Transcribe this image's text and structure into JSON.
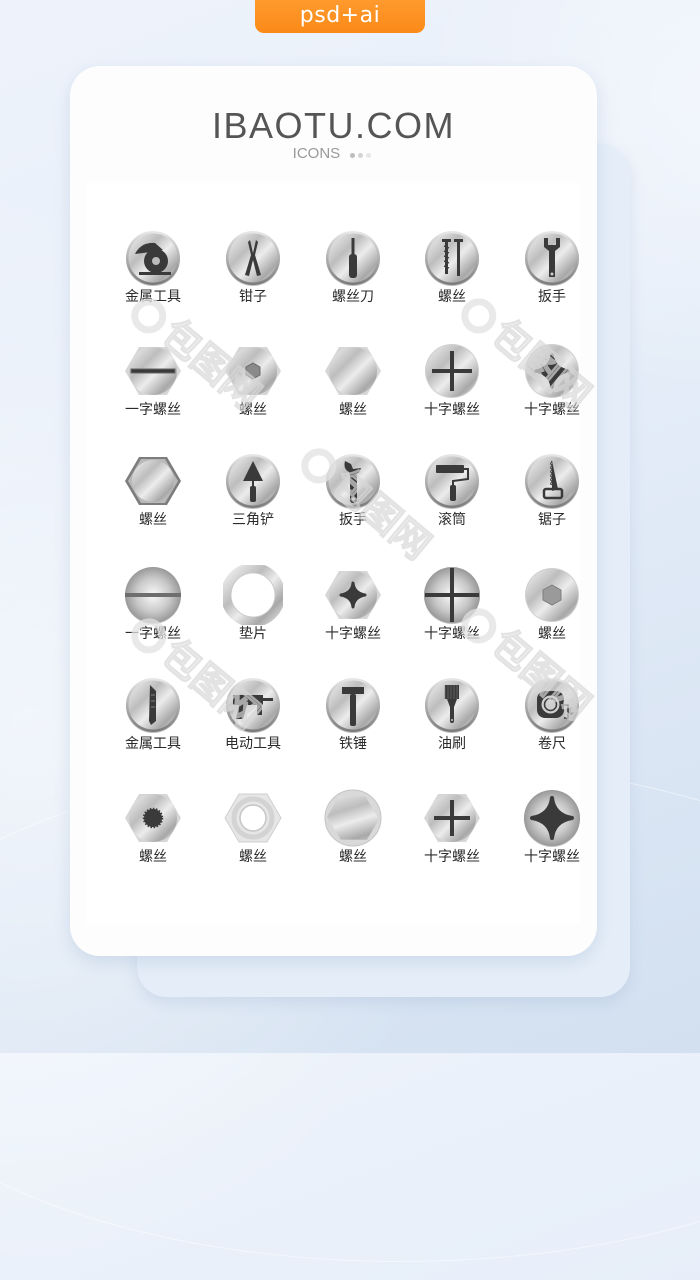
{
  "badge": {
    "label": "psd+ai"
  },
  "header": {
    "title": "IBAOTU.COM",
    "subtitle": "ICONS",
    "dot_colors": [
      "#bdbdbd",
      "#d3d3d3",
      "#e6e6e6"
    ]
  },
  "colors": {
    "badge_orange": "#fb8a17",
    "title_gray": "#555555",
    "subtitle_gray": "#999999",
    "label_dark": "#2b2b2b",
    "icon_dark": "#3a3a3a",
    "metal_light": "#f2f2f2",
    "metal_dark": "#8a8a8a"
  },
  "watermark": {
    "text": "包图网"
  },
  "icons": [
    {
      "label": "金属工具",
      "icon": "circular-saw-icon",
      "shape": "circle"
    },
    {
      "label": "钳子",
      "icon": "pliers-icon",
      "shape": "circle"
    },
    {
      "label": "螺丝刀",
      "icon": "screwdriver-icon",
      "shape": "circle"
    },
    {
      "label": "螺丝",
      "icon": "screws-icon",
      "shape": "circle"
    },
    {
      "label": "扳手",
      "icon": "wrench-icon",
      "shape": "circle"
    },
    {
      "label": "一字螺丝",
      "icon": "slotted-hex-bolt-icon",
      "shape": "hex"
    },
    {
      "label": "螺丝",
      "icon": "hex-socket-bolt-icon",
      "shape": "hex"
    },
    {
      "label": "螺丝",
      "icon": "plain-hex-bolt-icon",
      "shape": "hex"
    },
    {
      "label": "十字螺丝",
      "icon": "phillips-screw-icon",
      "shape": "circle-flat"
    },
    {
      "label": "十字螺丝",
      "icon": "phillips-screw-star-icon",
      "shape": "circle-flat"
    },
    {
      "label": "螺丝",
      "icon": "hex-nut-icon",
      "shape": "hex-dark"
    },
    {
      "label": "三角铲",
      "icon": "trowel-icon",
      "shape": "circle"
    },
    {
      "label": "扳手",
      "icon": "adjustable-wrench-icon",
      "shape": "circle"
    },
    {
      "label": "滚筒",
      "icon": "paint-roller-icon",
      "shape": "circle"
    },
    {
      "label": "锯子",
      "icon": "hand-saw-icon",
      "shape": "circle"
    },
    {
      "label": "一字螺丝",
      "icon": "slotted-round-screw-icon",
      "shape": "dome"
    },
    {
      "label": "垫片",
      "icon": "washer-icon",
      "shape": "ring"
    },
    {
      "label": "十字螺丝",
      "icon": "phillips-hex-bolt-icon",
      "shape": "hex"
    },
    {
      "label": "十字螺丝",
      "icon": "phillips-round-screw-icon",
      "shape": "dome"
    },
    {
      "label": "螺丝",
      "icon": "hex-socket-round-icon",
      "shape": "circle-flat"
    },
    {
      "label": "金属工具",
      "icon": "utility-knife-icon",
      "shape": "circle"
    },
    {
      "label": "电动工具",
      "icon": "power-drill-icon",
      "shape": "circle"
    },
    {
      "label": "铁锤",
      "icon": "hammer-icon",
      "shape": "circle"
    },
    {
      "label": "油刷",
      "icon": "paint-brush-icon",
      "shape": "circle"
    },
    {
      "label": "卷尺",
      "icon": "tape-measure-icon",
      "shape": "circle"
    },
    {
      "label": "螺丝",
      "icon": "torx-hex-bolt-icon",
      "shape": "hex"
    },
    {
      "label": "螺丝",
      "icon": "lock-nut-icon",
      "shape": "hex-nut"
    },
    {
      "label": "螺丝",
      "icon": "flange-hex-bolt-icon",
      "shape": "hex-in-circle"
    },
    {
      "label": "十字螺丝",
      "icon": "phillips-hex-screw-icon",
      "shape": "hex"
    },
    {
      "label": "十字螺丝",
      "icon": "phillips-pan-screw-icon",
      "shape": "dome"
    }
  ]
}
